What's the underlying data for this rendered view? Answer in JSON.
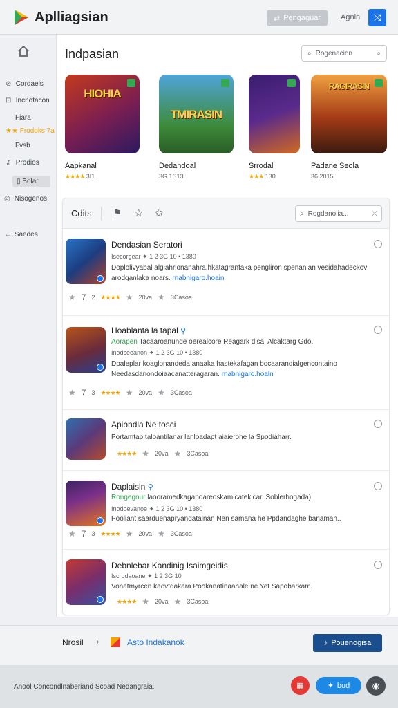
{
  "topbar": {
    "title": "Aplliagsian",
    "button_label": "Pengaguar",
    "link_label": "Agnin",
    "square_icon": "shuffle-icon"
  },
  "sidebar": {
    "items": [
      {
        "label": "Cordaels",
        "icon": "tag-icon"
      },
      {
        "label": "Incnotacon",
        "icon": "layers-icon"
      },
      {
        "label": "Fiara",
        "icon": ""
      },
      {
        "label": "Frodoks 7a",
        "rating": "★★"
      },
      {
        "label": "Fvsb",
        "icon": ""
      },
      {
        "label": "Prodios",
        "icon": "key-icon"
      },
      {
        "label": "Bolar",
        "icon": "bookmark-icon"
      },
      {
        "label": "Nisogenos",
        "icon": "globe-icon"
      },
      {
        "label": "Saedes",
        "icon": "arrow-left-icon"
      }
    ]
  },
  "main": {
    "title": "Indpasian",
    "search_placeholder": "Rogenacion",
    "cards": [
      {
        "name": "Aapkanal",
        "stars": "★★★★",
        "meta": "3I1",
        "art": "HIOHIA",
        "colors": [
          "#c43a1c",
          "#2b1a60"
        ]
      },
      {
        "name": "Dedandoal",
        "stars": "",
        "meta": "3G 1S13",
        "art": "TMIRASIN",
        "colors": [
          "#3d8b3a",
          "#7bc4e6"
        ]
      },
      {
        "name": "Srrodal",
        "stars": "★★★",
        "meta": "130",
        "art": "",
        "colors": [
          "#5a2a8c",
          "#d1691f"
        ]
      },
      {
        "name": "Padane Seola",
        "stars": "",
        "meta": "36 2015",
        "art": "RAGIRASIN",
        "colors": [
          "#a33a16",
          "#f0a040"
        ]
      }
    ]
  },
  "panel": {
    "title": "Cdits",
    "search_placeholder": "Rogdanolia...",
    "items": [
      {
        "title": "Dendasian Seratori",
        "sub": "Isecorgear ✦ 1 2 3G 10  •  1380",
        "desc": "Doplolivyabal algiahrionanahra.hkatagranfaka pengliron spenanlan vesidahadeckov arodganlaka noars.",
        "link": "rnabnigaro.hoain",
        "rating": "7",
        "count": "2",
        "stars": "★★★★",
        "votes": "20va",
        "meta": "3Casoa",
        "colors": [
          "#2a74c8",
          "#b1412b"
        ]
      },
      {
        "title": "Hoablanta la tapal",
        "green_prefix": "Aorapen",
        "green_text": "Tacaaroanunde oerealcore Reagark disa. Alcaktarg Gdo.",
        "sub": "Inodceeanon ✦ 1 2 3G 10  •  1380",
        "desc": "Dpaleplar koaglonandeda anaaka hastekafagan bocaarandialgencontaino Needasdanondoiaacanatteragaran.",
        "link": "rnabnigaro.hoaln",
        "rating": "7",
        "count": "3",
        "stars": "★★★★",
        "votes": "20va",
        "meta": "3Casoa",
        "colors": [
          "#b8541a",
          "#2a3f8f"
        ]
      },
      {
        "title": "Apiondla  Ne tosci",
        "desc": "Portamtap taloantilanar lanloadapt aiaierohe la Spodiaharr.",
        "stars": "★★★★",
        "votes": "20va",
        "meta": "3Casoa",
        "colors": [
          "#2f6fb1",
          "#b44b2a"
        ]
      },
      {
        "title": "Daplaisln",
        "green_prefix": "Rongegnur",
        "green_text": "laooramedkaganoareoskamicatekicar, Soblerhogada)",
        "sub": "Inodoevanoe ✦ 1 2 3G 10  •  1380",
        "desc": "Pooliant saarduenapryandatalnan Nen samana he Ppdandaghe banaman..",
        "rating": "7",
        "count": "3",
        "stars": "★★★★",
        "votes": "20va",
        "meta": "3Casoa",
        "colors": [
          "#7a2f8a",
          "#e0751f"
        ]
      },
      {
        "title": "Debnlebar Kandinig Isaimgeidis",
        "sub": "Iscrodaoane ✦ 1 2 3G 10",
        "desc": "Vonatmyrcen kaovtdakara Pookanatinaahale ne Yet Sapobarkam.",
        "stars": "★★★★",
        "votes": "20va",
        "meta": "3Casoa",
        "colors": [
          "#c23b32",
          "#3a4fa0"
        ]
      }
    ]
  },
  "bottombar": {
    "left_label": "Nrosil",
    "link_label": "Asto Indakanok",
    "button_label": "Pouenogisa"
  },
  "footer": {
    "text": "Anool Concondlnaberiand Scoad Nedangraia.",
    "button2_label": "bud"
  }
}
